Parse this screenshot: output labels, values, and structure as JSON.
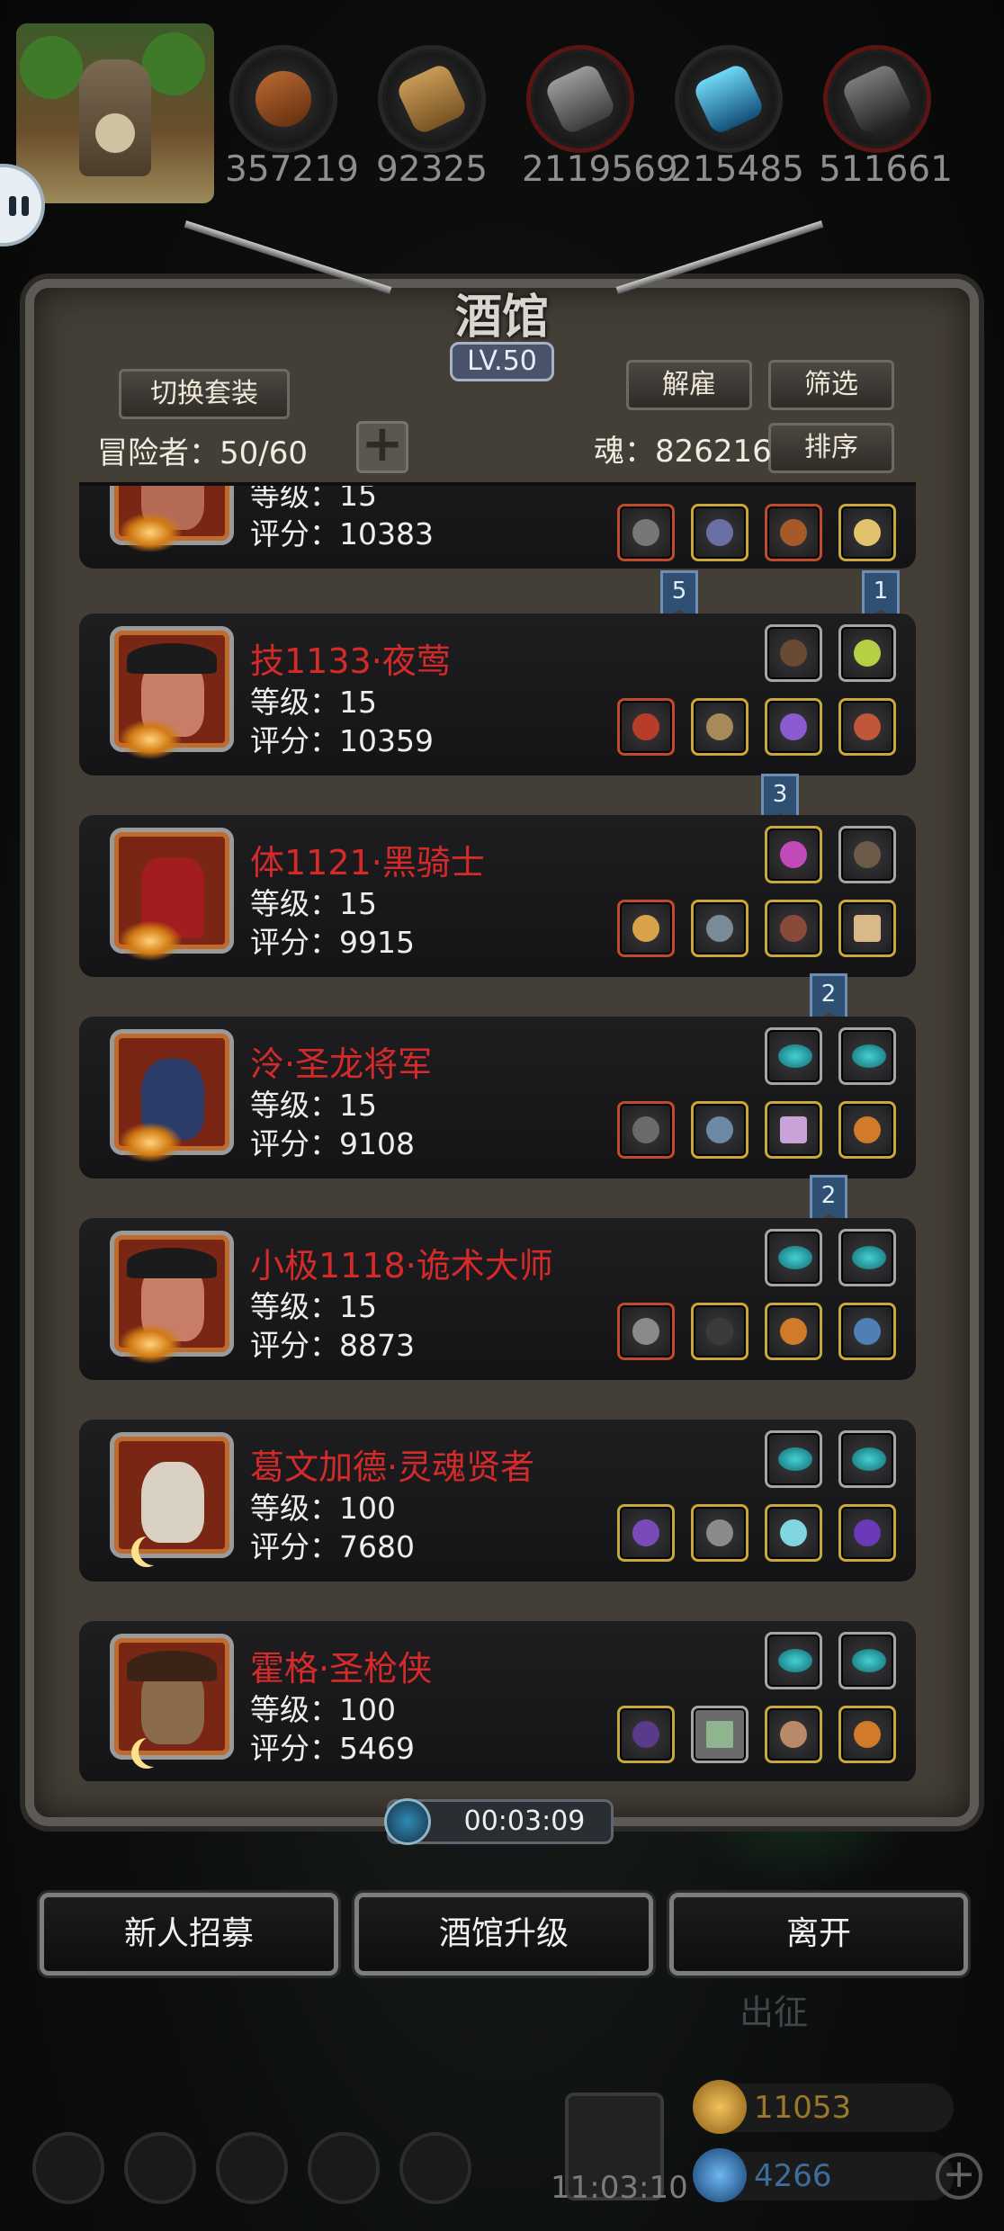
{
  "resources": [
    "357219",
    "92325",
    "2119569",
    "215485",
    "511661"
  ],
  "tavern": {
    "title": "酒馆",
    "level": "LV.50"
  },
  "toolbar": {
    "switch_outfit": "切换套装",
    "dismiss": "解雇",
    "filter": "筛选",
    "sort": "排序"
  },
  "adventurers": {
    "label": "冒险者：50/60",
    "add": "+"
  },
  "soul": {
    "label": "魂：826216"
  },
  "list": [
    {
      "name": "",
      "level": "等级：15",
      "score": "评分：10383"
    },
    {
      "name": "技1133·夜莺",
      "level": "等级：15",
      "score": "评分：10359",
      "ribbons": [
        "5",
        "1"
      ]
    },
    {
      "name": "体1121·黑骑士",
      "level": "等级：15",
      "score": "评分：9915",
      "ribbons": [
        "3"
      ]
    },
    {
      "name": "泠·圣龙将军",
      "level": "等级：15",
      "score": "评分：9108",
      "ribbons": [
        "2"
      ]
    },
    {
      "name": "小极1118·诡术大师",
      "level": "等级：15",
      "score": "评分：8873",
      "ribbons": [
        "2"
      ]
    },
    {
      "name": "葛文加德·灵魂贤者",
      "level": "等级：100",
      "score": "评分：7680"
    },
    {
      "name": "霍格·圣枪侠",
      "level": "等级：100",
      "score": "评分：5469"
    }
  ],
  "timer": "00:03:09",
  "bottom_buttons": {
    "recruit": "新人招募",
    "upgrade": "酒馆升级",
    "leave": "离开"
  },
  "background": {
    "expedition": "出征"
  },
  "footer": {
    "time": "11:03:10",
    "gold": "11053",
    "gems": "4266"
  },
  "colors": {
    "name_red": "#d52a2a",
    "ribbon_blue": "#2f4f73",
    "gold_border": "#c9a83a"
  }
}
